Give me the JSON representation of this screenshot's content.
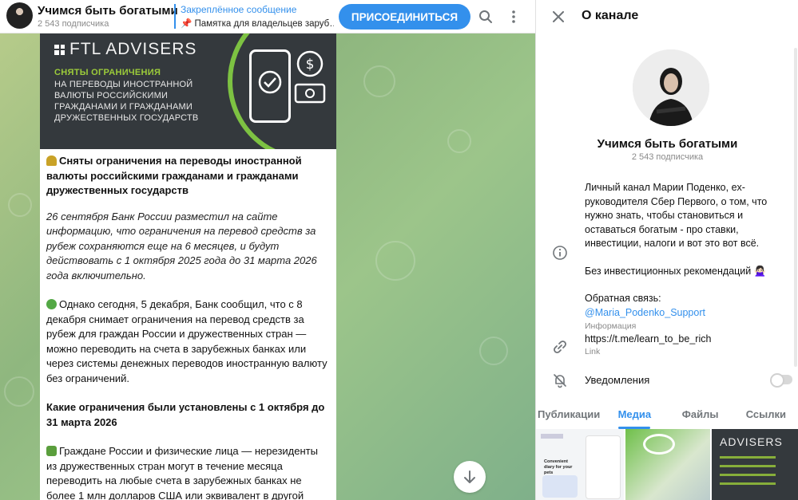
{
  "header": {
    "channel_name": "Учимся быть богатыми",
    "subscribers": "2 543 подписчика",
    "pinned_label": "Закреплённое сообщение",
    "pinned_text": "📌 Памятка для владельцев заруб…",
    "join_label": "ПРИСОЕДИНИТЬСЯ"
  },
  "message": {
    "banner_logo": "FTL ADVISERS",
    "banner_head": "СНЯТЫ ОГРАНИЧЕНИЯ",
    "banner_body": "НА ПЕРЕВОДЫ ИНОСТРАННОЙ ВАЛЮТЫ РОССИЙСКИМИ ГРАЖДАНАМИ И ГРАЖДАНАМИ ДРУЖЕСТВЕННЫХ ГОСУДАРСТВ",
    "headline": "Сняты ограничения на переводы иностранной валюты российскими гражданами и гражданами дружественных государств",
    "para1": "26 сентября Банк России разместил на сайте информацию, что ограничения на перевод средств за рубеж сохраняются еще на 6 месяцев, и будут действовать с 1 октября 2025 года до 31 марта 2026 года включительно.",
    "para2": "Однако сегодня, 5 декабря, Банк сообщил, что с 8 декабря снимает ограничения на перевод средств за рубеж для граждан России и дружественных стран — можно переводить на счета в зарубежных банках или через системы денежных переводов иностранную валюту без ограничений.",
    "subhead": "Какие ограничения были установлены с 1 октября до 31 марта 2026",
    "para3": "Граждане России и физические лица — нерезиденты из дружественных стран могут в течение месяца переводить на любые счета в зарубежных банках не более 1 млн долларов США или эквивалент в другой иностранной валюте."
  },
  "panel": {
    "title": "О канале",
    "name": "Учимся быть богатыми",
    "subscribers": "2 543 подписчика",
    "description": "Личный канал Марии Поденко, ex-руководителя Сбер Первого, о том, что нужно знать, чтобы становиться и оставаться богатым - про ставки, инвестиции, налоги и вот это вот всё.",
    "disclaimer": "Без инвестиционных рекомендаций 🙅🏻‍♀️",
    "feedback_label": "Обратная связь:",
    "feedback_link": "@Maria_Podenko_Support",
    "info_label": "Информация",
    "link_value": "https://t.me/learn_to_be_rich",
    "link_label": "Link",
    "notifications_label": "Уведомления",
    "notifications_enabled": false,
    "tabs": [
      "Публикации",
      "Медиа",
      "Файлы",
      "Ссылки"
    ],
    "active_tab": "Медиа",
    "thumb1_title": "Convenient diary for your pets",
    "thumb3_text": "ADVISERS"
  },
  "colors": {
    "accent": "#3390ec",
    "brand_green": "#7dc242"
  }
}
